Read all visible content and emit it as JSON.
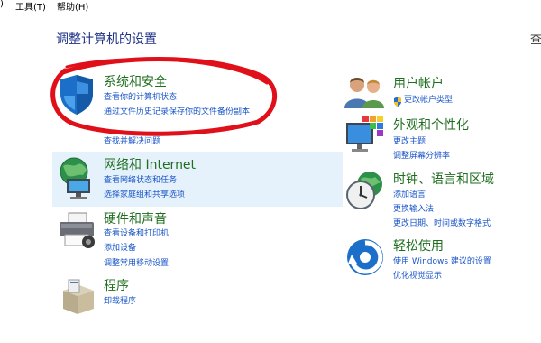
{
  "menu": {
    "view_partial": ")",
    "tools": "工具(T)",
    "help": "帮助(H)"
  },
  "page_title": "调整计算机的设置",
  "view_by_partial": "查",
  "left_categories": [
    {
      "title": "系统和安全",
      "links": [
        "查看你的计算机状态",
        "通过文件历史记录保存你的文件备份副本",
        "查找并解决问题"
      ]
    },
    {
      "title": "网络和 Internet",
      "links": [
        "查看网络状态和任务",
        "选择家庭组和共享选项"
      ]
    },
    {
      "title": "硬件和声音",
      "links": [
        "查看设备和打印机",
        "添加设备",
        "调整常用移动设置"
      ]
    },
    {
      "title": "程序",
      "links": [
        "卸载程序"
      ]
    }
  ],
  "right_categories": [
    {
      "title": "用户帐户",
      "links": [
        "更改帐户类型"
      ]
    },
    {
      "title": "外观和个性化",
      "links": [
        "更改主题",
        "调整屏幕分辨率"
      ]
    },
    {
      "title": "时钟、语言和区域",
      "links": [
        "添加语言",
        "更换输入法",
        "更改日期、时间或数字格式"
      ]
    },
    {
      "title": "轻松使用",
      "links": [
        "使用 Windows 建议的设置",
        "优化视觉显示"
      ]
    }
  ],
  "colors": {
    "title": "#1e3287",
    "category": "#1e6e1e",
    "link": "#1a55c8",
    "highlight": "#e5f1fb",
    "annotation": "#e0101a"
  },
  "icons": {
    "system_security": "shield-icon",
    "network": "globe-icon",
    "hardware": "printer-icon",
    "programs": "programs-box-icon",
    "user_accounts": "users-icon",
    "appearance": "monitor-palette-icon",
    "clock": "clock-globe-icon",
    "ease_of_access": "ease-of-access-icon"
  }
}
